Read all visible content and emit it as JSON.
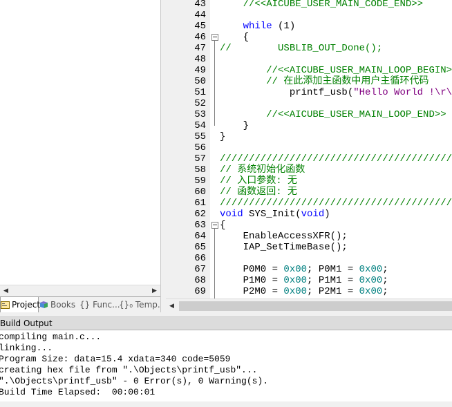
{
  "project_pane": {
    "tabs": [
      {
        "label": "Project",
        "icon": "project-icon",
        "active": true
      },
      {
        "label": "Books",
        "icon": "books-icon",
        "active": false
      },
      {
        "label": "{} Func...",
        "icon": "functions-icon",
        "active": false
      },
      {
        "label": "{}₀ Temp...",
        "icon": "templates-icon",
        "active": false
      }
    ]
  },
  "editor": {
    "lines": [
      {
        "num": "43",
        "parts": [
          {
            "t": "    ",
            "c": ""
          },
          {
            "t": "//<<AICUBE_USER_MAIN_CODE_END>>",
            "c": "cm"
          }
        ]
      },
      {
        "num": "44",
        "parts": []
      },
      {
        "num": "45",
        "parts": [
          {
            "t": "    ",
            "c": ""
          },
          {
            "t": "while",
            "c": "kw"
          },
          {
            "t": " (1)",
            "c": ""
          }
        ]
      },
      {
        "num": "46",
        "fold": "box",
        "parts": [
          {
            "t": "    {",
            "c": ""
          }
        ]
      },
      {
        "num": "47",
        "parts": [
          {
            "t": "//        USBLIB_OUT_Done();",
            "c": "cm"
          }
        ]
      },
      {
        "num": "48",
        "parts": []
      },
      {
        "num": "49",
        "parts": [
          {
            "t": "        ",
            "c": ""
          },
          {
            "t": "//<<AICUBE_USER_MAIN_LOOP_BEGIN>>",
            "c": "cm"
          }
        ]
      },
      {
        "num": "50",
        "parts": [
          {
            "t": "        ",
            "c": ""
          },
          {
            "t": "// 在此添加主函数中用户主循环代码",
            "c": "cm"
          }
        ]
      },
      {
        "num": "51",
        "parts": [
          {
            "t": "            printf_usb(",
            "c": ""
          },
          {
            "t": "\"Hello World !\\r\\n\"",
            "c": "str"
          }
        ]
      },
      {
        "num": "52",
        "parts": []
      },
      {
        "num": "53",
        "parts": [
          {
            "t": "        ",
            "c": ""
          },
          {
            "t": "//<<AICUBE_USER_MAIN_LOOP_END>>",
            "c": "cm"
          }
        ]
      },
      {
        "num": "54",
        "fold": "end",
        "parts": [
          {
            "t": "    }",
            "c": ""
          }
        ]
      },
      {
        "num": "55",
        "fold": "end",
        "parts": [
          {
            "t": "}",
            "c": ""
          }
        ]
      },
      {
        "num": "56",
        "parts": []
      },
      {
        "num": "57",
        "parts": [
          {
            "t": "////////////////////////////////////////",
            "c": "cm"
          }
        ]
      },
      {
        "num": "58",
        "parts": [
          {
            "t": "// 系统初始化函数",
            "c": "cm"
          }
        ]
      },
      {
        "num": "59",
        "parts": [
          {
            "t": "// 入口参数: 无",
            "c": "cm"
          }
        ]
      },
      {
        "num": "60",
        "parts": [
          {
            "t": "// 函数返回: 无",
            "c": "cm"
          }
        ]
      },
      {
        "num": "61",
        "parts": [
          {
            "t": "////////////////////////////////////////",
            "c": "cm"
          }
        ]
      },
      {
        "num": "62",
        "parts": [
          {
            "t": "void",
            "c": "kw"
          },
          {
            "t": " SYS_Init(",
            "c": ""
          },
          {
            "t": "void",
            "c": "kw"
          },
          {
            "t": ")",
            "c": ""
          }
        ]
      },
      {
        "num": "63",
        "fold": "box",
        "parts": [
          {
            "t": "{",
            "c": ""
          }
        ]
      },
      {
        "num": "64",
        "parts": [
          {
            "t": "    EnableAccessXFR();                  ",
            "c": ""
          },
          {
            "t": "//",
            "c": "cm"
          }
        ]
      },
      {
        "num": "65",
        "parts": [
          {
            "t": "    IAP_SetTimeBase();                  ",
            "c": ""
          },
          {
            "t": "//",
            "c": "cm"
          }
        ]
      },
      {
        "num": "66",
        "parts": []
      },
      {
        "num": "67",
        "parts": [
          {
            "t": "    P0M0 = ",
            "c": ""
          },
          {
            "t": "0x00",
            "c": "num"
          },
          {
            "t": "; P0M1 = ",
            "c": ""
          },
          {
            "t": "0x00",
            "c": "num"
          },
          {
            "t": ";           ",
            "c": ""
          },
          {
            "t": "//",
            "c": "cm"
          }
        ]
      },
      {
        "num": "68",
        "parts": [
          {
            "t": "    P1M0 = ",
            "c": ""
          },
          {
            "t": "0x00",
            "c": "num"
          },
          {
            "t": "; P1M1 = ",
            "c": ""
          },
          {
            "t": "0x00",
            "c": "num"
          },
          {
            "t": ";           ",
            "c": ""
          },
          {
            "t": "//",
            "c": "cm"
          }
        ]
      },
      {
        "num": "69",
        "parts": [
          {
            "t": "    P2M0 = ",
            "c": ""
          },
          {
            "t": "0x00",
            "c": "num"
          },
          {
            "t": "; P2M1 = ",
            "c": ""
          },
          {
            "t": "0x00",
            "c": "num"
          },
          {
            "t": ";           ",
            "c": ""
          },
          {
            "t": "//",
            "c": "cm"
          }
        ]
      }
    ]
  },
  "build_output": {
    "title": "Build Output",
    "lines": [
      "compiling main.c...",
      "linking...",
      "Program Size: data=15.4 xdata=340 code=5059",
      "creating hex file from \".\\Objects\\printf_usb\"...",
      "\".\\Objects\\printf_usb\" - 0 Error(s), 0 Warning(s).",
      "Build Time Elapsed:  00:00:01"
    ]
  }
}
